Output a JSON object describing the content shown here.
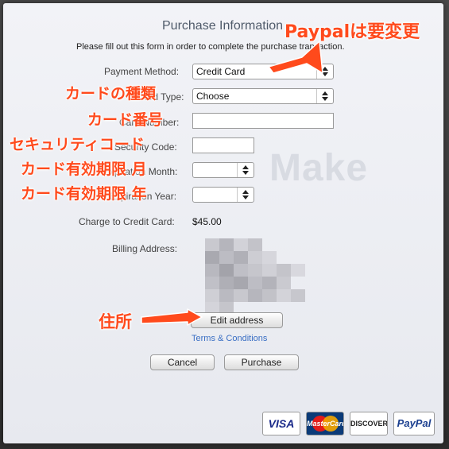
{
  "title": "Purchase Information",
  "subtitle": "Please fill out this form in order to complete the purchase transaction.",
  "watermark": "Make",
  "labels": {
    "payment_method": "Payment Method:",
    "card_type": "Card Type:",
    "card_number": "Card Number:",
    "security_code": "Security Code:",
    "exp_month": "Expiration Month:",
    "exp_year": "Expiration Year:",
    "charge": "Charge to Credit Card:",
    "billing": "Billing Address:"
  },
  "fields": {
    "payment_method_value": "Credit Card",
    "card_type_value": "Choose",
    "charge_value": "$45.00"
  },
  "buttons": {
    "edit_address": "Edit address",
    "cancel": "Cancel",
    "purchase": "Purchase"
  },
  "links": {
    "terms": "Terms & Conditions"
  },
  "cards": [
    "VISA",
    "MasterCard",
    "DISCOVER",
    "PayPal"
  ],
  "annotations": {
    "paypal": "Paypalは要変更",
    "card_type": "カードの種類",
    "card_number": "カード番号",
    "security_code": "セキュリティコード",
    "exp_month": "カード有効期限 月",
    "exp_year": "カード有効期限 年",
    "address": "住所"
  },
  "colors": {
    "annotation": "#ff4a1c",
    "link": "#3a6fc4"
  }
}
